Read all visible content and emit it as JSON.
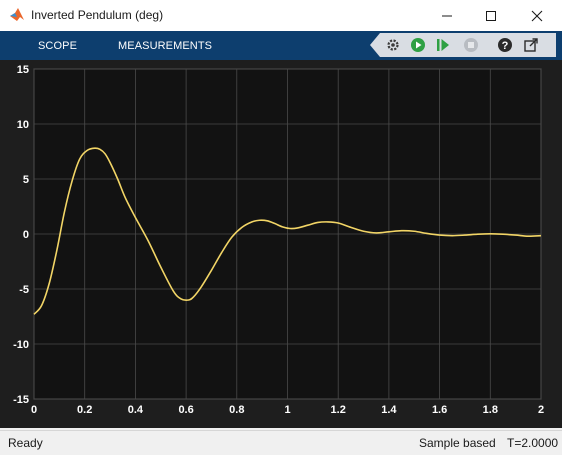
{
  "window": {
    "title": "Inverted Pendulum (deg)",
    "icon": "matlab-logo-icon",
    "controls": [
      "minimize-icon",
      "maximize-icon",
      "close-icon"
    ]
  },
  "toolstrip": {
    "tabs": [
      {
        "label": "SCOPE"
      },
      {
        "label": "MEASUREMENTS"
      }
    ],
    "tools": [
      "settings-gear-icon",
      "run-icon",
      "step-forward-icon",
      "stop-icon",
      "help-icon",
      "undock-icon"
    ]
  },
  "colors": {
    "toolstrip": "#0d3e6e",
    "plot_background": "#121212",
    "frame": "#1e1e1e",
    "grid": "#4a4a4a",
    "signal": "#f2d566",
    "tick_text": "#ffffff"
  },
  "chart_data": {
    "type": "line",
    "title": "",
    "xlabel": "",
    "ylabel": "",
    "xlim": [
      0,
      2
    ],
    "ylim": [
      -15,
      15
    ],
    "xticks": [
      "0",
      "0.2",
      "0.4",
      "0.6",
      "0.8",
      "1",
      "1.2",
      "1.4",
      "1.6",
      "1.8",
      "2"
    ],
    "yticks": [
      "15",
      "10",
      "5",
      "0",
      "-5",
      "-10",
      "-15"
    ],
    "grid": true,
    "series": [
      {
        "color": "#f2d566",
        "x": [
          0,
          0.03,
          0.06,
          0.09,
          0.12,
          0.15,
          0.18,
          0.21,
          0.24,
          0.26,
          0.28,
          0.3,
          0.33,
          0.36,
          0.4,
          0.45,
          0.5,
          0.55,
          0.58,
          0.61,
          0.63,
          0.66,
          0.7,
          0.74,
          0.78,
          0.82,
          0.86,
          0.89,
          0.92,
          0.95,
          0.98,
          1.01,
          1.04,
          1.08,
          1.12,
          1.16,
          1.2,
          1.25,
          1.3,
          1.35,
          1.4,
          1.45,
          1.5,
          1.55,
          1.6,
          1.65,
          1.7,
          1.75,
          1.8,
          1.85,
          1.9,
          1.95,
          2.0
        ],
        "y": [
          -7.3,
          -6.5,
          -4.5,
          -1.5,
          2.0,
          4.8,
          6.8,
          7.6,
          7.8,
          7.7,
          7.3,
          6.5,
          5.0,
          3.3,
          1.5,
          -0.6,
          -3.0,
          -5.2,
          -5.9,
          -6.0,
          -5.7,
          -4.8,
          -3.3,
          -1.7,
          -0.3,
          0.6,
          1.1,
          1.25,
          1.2,
          0.95,
          0.65,
          0.5,
          0.55,
          0.8,
          1.05,
          1.1,
          1.0,
          0.6,
          0.25,
          0.1,
          0.2,
          0.3,
          0.25,
          0.05,
          -0.1,
          -0.15,
          -0.1,
          -0.02,
          0.02,
          -0.02,
          -0.1,
          -0.2,
          -0.15
        ]
      }
    ]
  },
  "status": {
    "left": "Ready",
    "mode": "Sample based",
    "time": "T=2.0000"
  }
}
